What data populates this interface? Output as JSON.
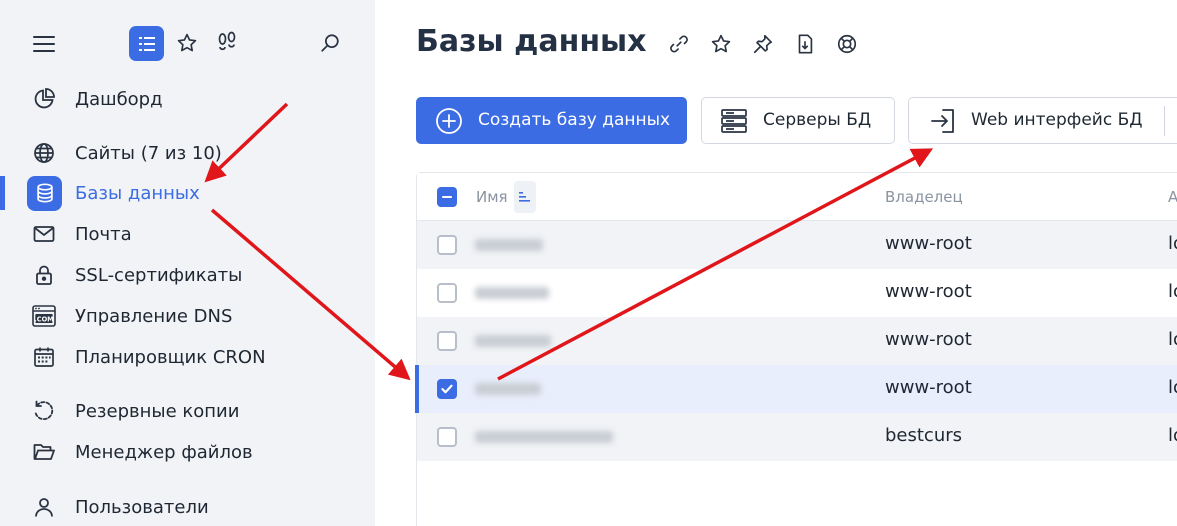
{
  "sidebar": {
    "top_icons": [
      "menu-icon",
      "list-icon",
      "star-icon",
      "footsteps-icon",
      "search-icon"
    ],
    "items": [
      {
        "label": "Дашборд",
        "icon": "pie-chart-icon"
      },
      {
        "label": "Сайты (7 из 10)",
        "icon": "globe-icon"
      },
      {
        "label": "Базы данных",
        "icon": "database-icon",
        "active": true
      },
      {
        "label": "Почта",
        "icon": "mail-icon"
      },
      {
        "label": "SSL-сертификаты",
        "icon": "lock-icon"
      },
      {
        "label": "Управление DNS",
        "icon": "dns-com-icon"
      },
      {
        "label": "Планировщик CRON",
        "icon": "calendar-icon"
      },
      {
        "label": "Резервные копии",
        "icon": "backup-icon"
      },
      {
        "label": "Менеджер файлов",
        "icon": "folder-icon"
      },
      {
        "label": "Пользователи",
        "icon": "user-icon"
      }
    ]
  },
  "main": {
    "title": "Базы данных",
    "title_tools": [
      "link-icon",
      "star-icon",
      "pin-icon",
      "download-doc-icon",
      "help-lifebuoy-icon"
    ],
    "toolbar": {
      "create_label": "Создать базу данных",
      "servers_label": "Серверы БД",
      "web_label": "Web интерфейс БД"
    },
    "table": {
      "columns": {
        "name": "Имя",
        "owner": "Владелец",
        "third": "А"
      },
      "rows": [
        {
          "owner": "www-root",
          "third": "lo",
          "selected": false
        },
        {
          "owner": "www-root",
          "third": "lo",
          "selected": false
        },
        {
          "owner": "www-root",
          "third": "lo",
          "selected": false
        },
        {
          "owner": "www-root",
          "third": "lo",
          "selected": true
        },
        {
          "owner": "bestcurs",
          "third": "lo",
          "selected": false
        }
      ]
    }
  },
  "colors": {
    "accent": "#3c6ce3",
    "annotation_arrow": "#e0161b",
    "sidebar_bg": "#f1f3f6",
    "selected_row_bg": "#e8eefc"
  }
}
